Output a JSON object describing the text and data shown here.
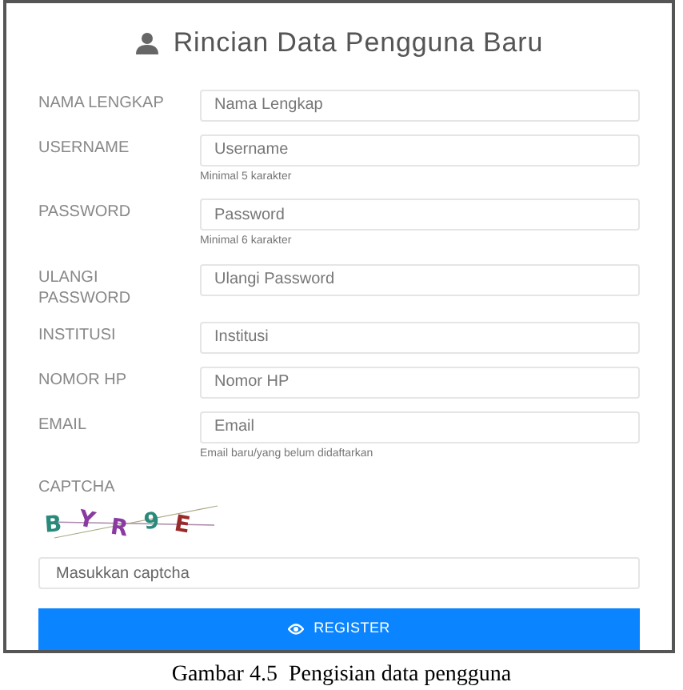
{
  "title": "Rincian Data Pengguna Baru",
  "fields": [
    {
      "label": "NAMA LENGKAP",
      "placeholder": "Nama Lengkap"
    },
    {
      "label": "USERNAME",
      "placeholder": "Username",
      "hint": "Minimal 5 karakter"
    },
    {
      "label": "PASSWORD",
      "placeholder": "Password",
      "hint": "Minimal 6 karakter"
    },
    {
      "label": "ULANGI PASSWORD",
      "placeholder": "Ulangi Password"
    },
    {
      "label": "INSTITUSI",
      "placeholder": "Institusi"
    },
    {
      "label": "NOMOR HP",
      "placeholder": "Nomor HP"
    },
    {
      "label": "EMAIL",
      "placeholder": "Email",
      "hint": "Email baru/yang belum didaftarkan"
    }
  ],
  "captcha": {
    "label": "CAPTCHA",
    "chars": [
      {
        "char": "B",
        "color": "#2a8a7a"
      },
      {
        "char": "Y",
        "color": "#8a3aa0"
      },
      {
        "char": "R",
        "color": "#8a3aa0"
      },
      {
        "char": "9",
        "color": "#2a8a7a"
      },
      {
        "char": "E",
        "color": "#9a2a2a"
      }
    ],
    "placeholder": "Masukkan captcha"
  },
  "button": "REGISTER",
  "caption": "Gambar 4.5  Pengisian data pengguna"
}
